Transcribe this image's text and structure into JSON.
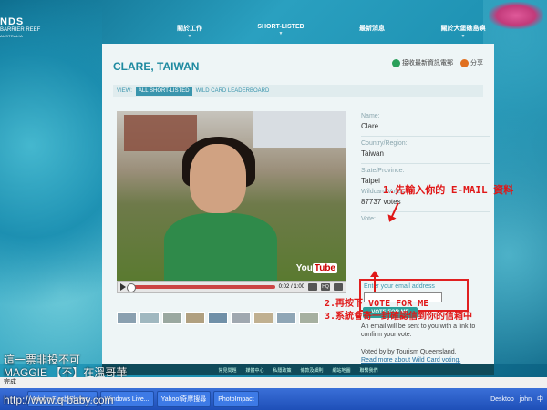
{
  "header": {
    "logo_top": "NDS",
    "logo_mid": "BARRIER REEF",
    "logo_sub": "AUSTRALIA",
    "nav": [
      "關於工作",
      "SHORT-LISTED",
      "最新消息",
      "關於大堡礁島嶼"
    ]
  },
  "panel": {
    "title": "CLARE, TAIWAN",
    "subscribe_label": "接收最新資訊電郵",
    "share_label": "分享",
    "view_label": "VIEW:",
    "view_tabs": [
      "ALL SHORT-LISTED",
      "WILD CARD LEADERBOARD"
    ]
  },
  "video": {
    "time": "0:02 / 1:00",
    "youtube_label": "You",
    "youtube_tube": "Tube",
    "hq_label": "HQ",
    "progress": 0.03
  },
  "info": {
    "name_label": "Name:",
    "name": "Clare",
    "country_label": "Country/Region:",
    "country": "Taiwan",
    "state_label": "State/Province:",
    "state": "Taipei",
    "votes_label": "Wildcard Votes:",
    "votes": "87737 votes",
    "vote_label": "Vote:",
    "email_placeholder": "Enter your email address",
    "vote_button": "VOTE FOR ME",
    "note_1": "An email will be sent to you with a link to confirm your vote.",
    "note_2": "Voted by by Tourism Queensland.",
    "read_more": "Read more about Wild Card voting."
  },
  "annotations": {
    "step1": "1.先輸入你的 E-MAIL 資料",
    "step2": "2.再按下 VOTE FOR ME",
    "step3": "3.系統會寄一封確認信到你的信箱中"
  },
  "footer": {
    "links": [
      "常見問題",
      "媒體中心",
      "私隱政策",
      "條款及細則",
      "網站地圖",
      "聯繫我們"
    ]
  },
  "overlay": {
    "line1": "這一票非投不可",
    "line2": "MAGGIE 【不】在溫哥華",
    "line3": "http://www.q-baby.com"
  },
  "status_bar": {
    "text": "完成"
  },
  "taskbar": {
    "items": [
      "Adobe Flash Player...",
      "Windows Live...",
      "Yahoo!奇摩搜尋",
      "PhotoImpact"
    ],
    "desktop": "Desktop",
    "user": "john",
    "ime": "中"
  }
}
